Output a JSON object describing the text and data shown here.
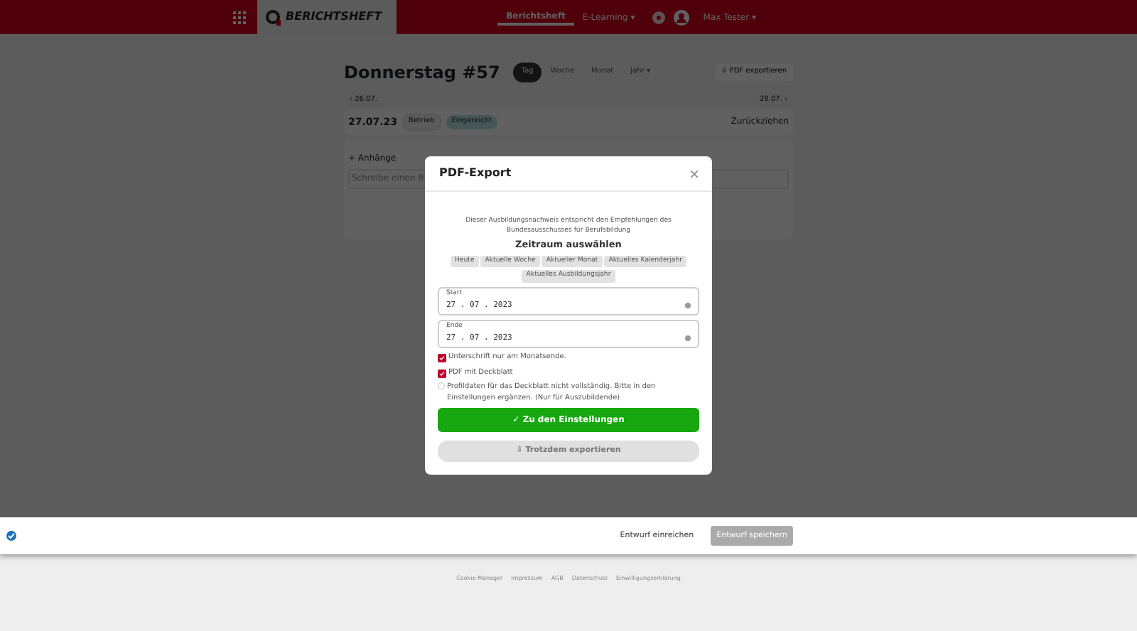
{
  "navbar": {
    "brand": "BERICHTSHEFT",
    "links": [
      {
        "label": "Berichtsheft",
        "selected": true
      },
      {
        "label": "E-Learning ▾",
        "selected": false
      }
    ],
    "user": "Max Tester ▾"
  },
  "page": {
    "title": "Donnerstag #57",
    "views": [
      {
        "label": "Tag",
        "selected": true
      },
      {
        "label": "Woche",
        "selected": false
      },
      {
        "label": "Monat",
        "selected": false
      },
      {
        "label": "Jahr ▾",
        "selected": false
      }
    ],
    "export_button": "⇩ PDF exportieren",
    "pager": {
      "prev": "‹ 26.07.",
      "next": "28.07. ›"
    },
    "entry": {
      "date": "27.07.23",
      "tag": "Betrieb",
      "status": "Eingereicht",
      "action": "Zurückziehen"
    },
    "attachments": "+ Anhänge",
    "editor_placeholder": "Schreibe einen B"
  },
  "modal": {
    "title": "PDF-Export",
    "intro": "Dieser Ausbildungsnachweis entspricht den Empfehlungen des Bundesausschusses für Berufsbildung",
    "range_heading": "Zeitraum auswählen",
    "ranges": [
      {
        "label": "Heute"
      },
      {
        "label": "Aktuelle Woche"
      },
      {
        "label": "Aktueller Monat"
      },
      {
        "label": "Aktuelles Kalenderjahr"
      },
      {
        "label": "Aktuelles Ausbildungsjahr"
      }
    ],
    "dates": [
      {
        "label": "Start",
        "value": "27 . 07 . 2023"
      },
      {
        "label": "Ende",
        "value": "27 . 07 . 2023"
      }
    ],
    "options": [
      {
        "label": "Unterschrift nur am Monatsende.",
        "checked": true
      },
      {
        "label": "PDF mit Deckblatt",
        "checked": true
      }
    ],
    "notice": "Profildaten für das Deckblatt nicht vollständig. Bitte in den Einstellungen ergänzen. (Nur für Auszubildende)",
    "primary_button": "✓ Zu den Einstellungen",
    "secondary_button": {
      "label": "⇩ Trotzdem exportieren",
      "disabled": true
    }
  },
  "bottom_bar": {
    "buttons": [
      {
        "label": "Entwurf einreichen",
        "disabled": false
      },
      {
        "label": "Entwurf speichern",
        "disabled": true
      }
    ]
  },
  "footer": {
    "links": [
      "Cookie-Manager",
      "Impressum",
      "AGB",
      "Datenschutz",
      "Einwilligungserklärung"
    ]
  }
}
